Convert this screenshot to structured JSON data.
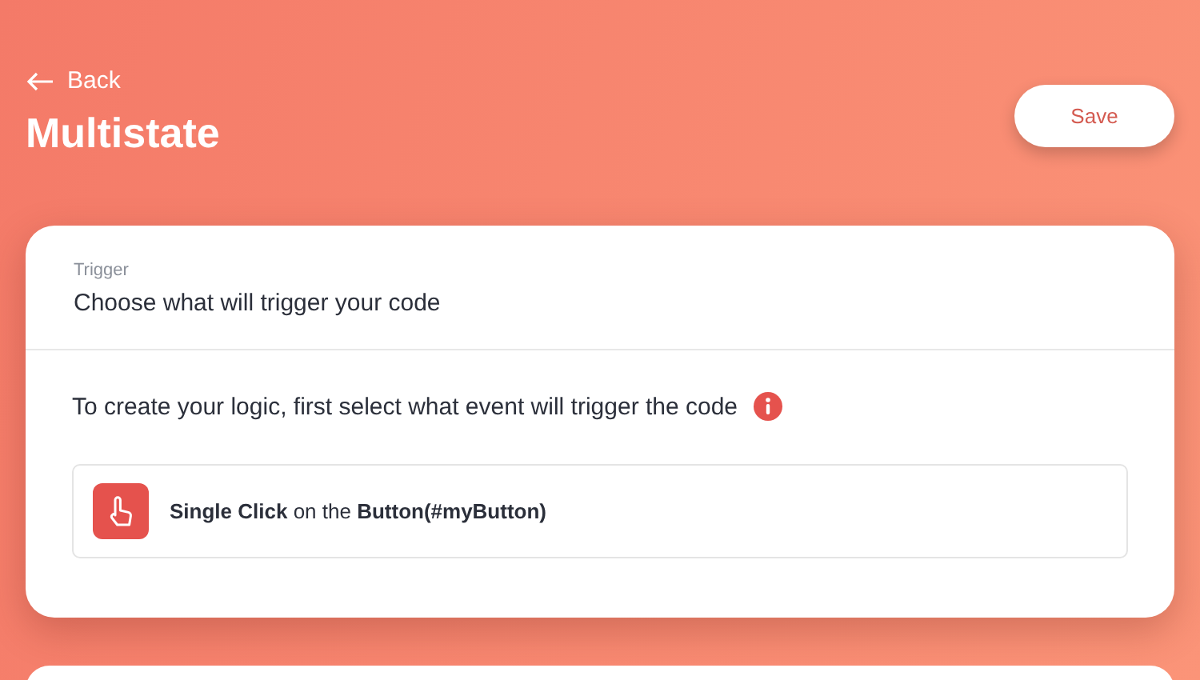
{
  "back": {
    "label": "Back"
  },
  "page_title": "Multistate",
  "save_button": "Save",
  "trigger_card": {
    "eyebrow": "Trigger",
    "title": "Choose what will trigger your code",
    "description": "To create your logic, first select what event will trigger the code",
    "trigger": "**Single Click** on the **Button(#myButton)**"
  }
}
